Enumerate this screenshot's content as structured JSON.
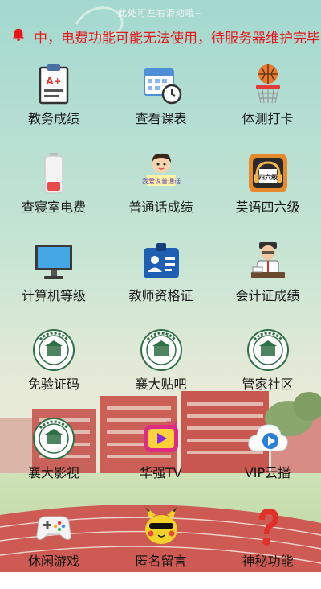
{
  "header": {
    "hint": "此处可左右滑动哦~",
    "notice": "中，电费功能可能无法使用，待服务器维护完毕后"
  },
  "tiles": [
    {
      "label": "教务成绩",
      "icon": "report-card-icon"
    },
    {
      "label": "查看课表",
      "icon": "calendar-clock-icon"
    },
    {
      "label": "体测打卡",
      "icon": "basketball-hoop-icon"
    },
    {
      "label": "查寝室电费",
      "icon": "battery-icon"
    },
    {
      "label": "普通话成绩",
      "icon": "speaking-girl-icon",
      "icon_text": "我爱说普通话"
    },
    {
      "label": "英语四六级",
      "icon": "cet-icon",
      "icon_text": "四六级"
    },
    {
      "label": "计算机等级",
      "icon": "computer-monitor-icon"
    },
    {
      "label": "教师资格证",
      "icon": "id-badge-icon"
    },
    {
      "label": "会计证成绩",
      "icon": "accountant-icon"
    },
    {
      "label": "免验证码",
      "icon": "university-seal-icon"
    },
    {
      "label": "襄大贴吧",
      "icon": "university-seal-icon"
    },
    {
      "label": "管家社区",
      "icon": "university-seal-icon"
    },
    {
      "label": "襄大影视",
      "icon": "university-seal-icon"
    },
    {
      "label": "华强TV",
      "icon": "play-tv-icon",
      "icon_text": "TV"
    },
    {
      "label": "VIP云播",
      "icon": "cloud-play-icon"
    },
    {
      "label": "休闲游戏",
      "icon": "gamepad-icon"
    },
    {
      "label": "匿名留言",
      "icon": "pikachu-face-icon"
    },
    {
      "label": "神秘功能",
      "icon": "question-mark-icon"
    }
  ],
  "colors": {
    "notice": "#e8161a",
    "sky_top": "#9fd6cf",
    "track": "#c9564e"
  }
}
